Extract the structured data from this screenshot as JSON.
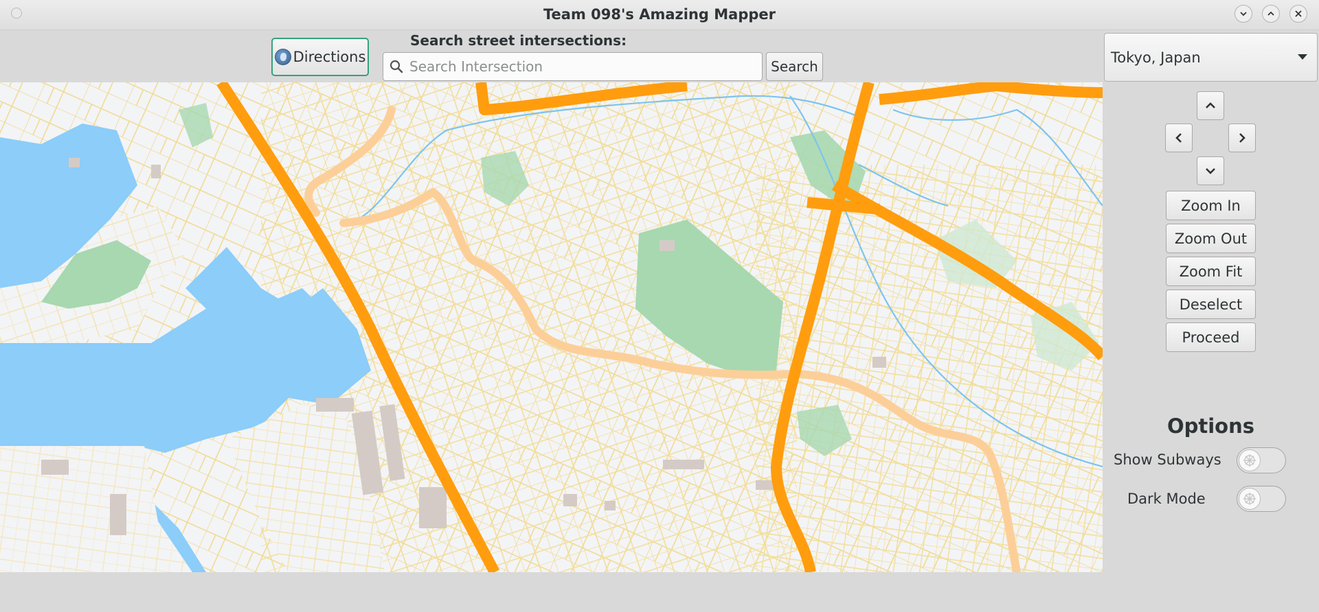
{
  "window": {
    "title": "Team 098's Amazing Mapper"
  },
  "toolbar": {
    "directions_label": "Directions",
    "search_label": "Search street intersections:",
    "search_placeholder": "Search Intersection",
    "search_value": "",
    "search_button": "Search"
  },
  "city_select": {
    "selected": "Tokyo, Japan"
  },
  "controls": {
    "zoom_in": "Zoom In",
    "zoom_out": "Zoom Out",
    "zoom_fit": "Zoom Fit",
    "deselect": "Deselect",
    "proceed": "Proceed"
  },
  "options": {
    "title": "Options",
    "show_subways": {
      "label": "Show Subways",
      "on": false
    },
    "dark_mode": {
      "label": "Dark Mode",
      "on": false
    }
  },
  "icons": {
    "nav": [
      "chevron-up-icon",
      "chevron-left-icon",
      "chevron-right-icon",
      "chevron-down-icon"
    ],
    "window_controls": [
      "minimize-icon",
      "maximize-icon",
      "close-icon"
    ]
  },
  "map_colors": {
    "background": "#f3f4f6",
    "water": "#8ccdf9",
    "park": "#a7d8b0",
    "building": "#d4cbc6",
    "minor_road": "#f3dd97",
    "arterial": "#fccf99",
    "highway": "#ff9d0e",
    "river": "#7cc4ef"
  }
}
